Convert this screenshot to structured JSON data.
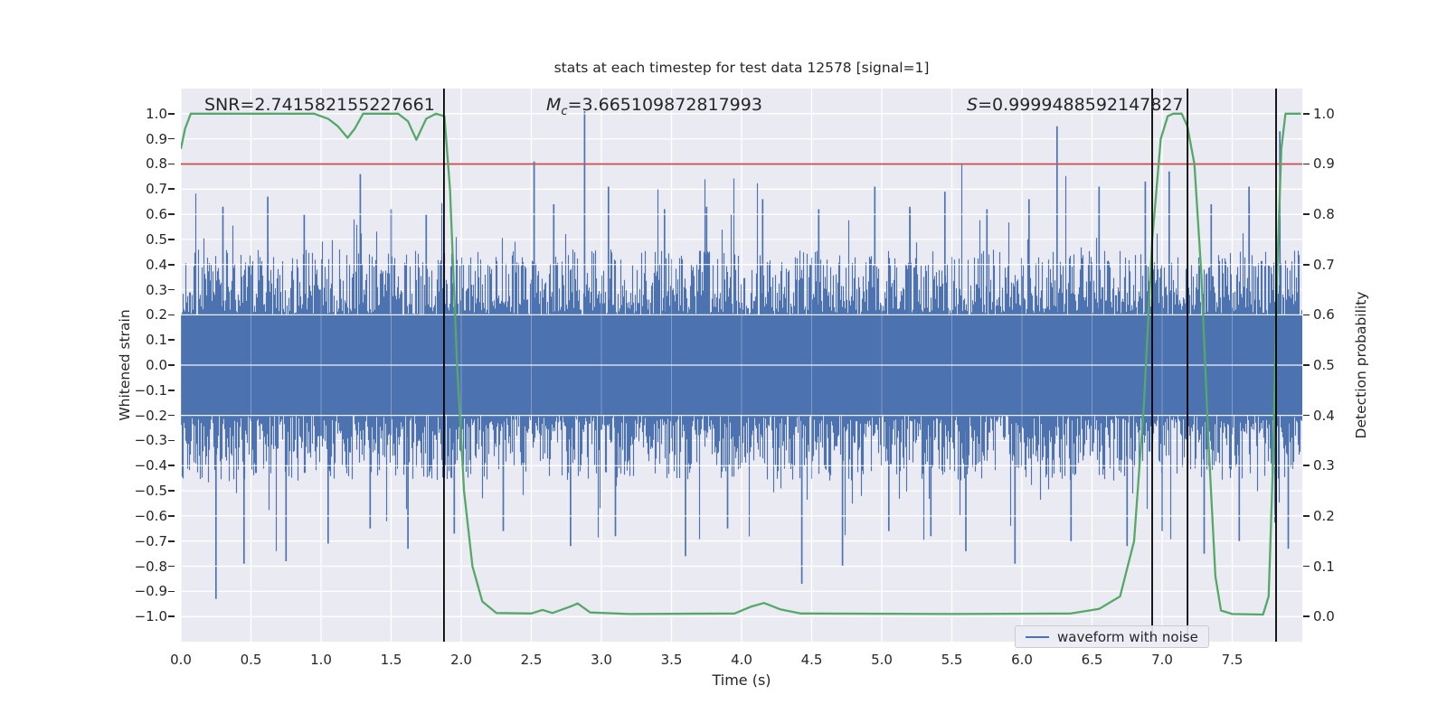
{
  "title": "stats at each timestep for test data 12578 [signal=1]",
  "annotations": {
    "snr": {
      "text": "SNR=2.741582155227661"
    },
    "chirp_mass": {
      "symbol": "M",
      "subscript": "c",
      "value": "=3.665109872817993"
    },
    "score": {
      "symbol": "S",
      "value": "=0.9999488592147827"
    }
  },
  "axes": {
    "x": {
      "label": "Time (s)",
      "range": [
        0.0,
        8.0
      ],
      "ticks": [
        0.0,
        0.5,
        1.0,
        1.5,
        2.0,
        2.5,
        3.0,
        3.5,
        4.0,
        4.5,
        5.0,
        5.5,
        6.0,
        6.5,
        7.0,
        7.5
      ]
    },
    "y_left": {
      "label": "Whitened strain",
      "range": [
        -1.1,
        1.1
      ],
      "ticks": [
        1.0,
        0.9,
        0.8,
        0.7,
        0.6,
        0.5,
        0.4,
        0.3,
        0.2,
        0.1,
        0.0,
        -0.1,
        -0.2,
        -0.3,
        -0.4,
        -0.5,
        -0.6,
        -0.7,
        -0.8,
        -0.9,
        -1.0
      ]
    },
    "y_right": {
      "label": "Detection probability",
      "range": [
        -0.05,
        1.05
      ],
      "ticks": [
        1.0,
        0.9,
        0.8,
        0.7,
        0.6,
        0.5,
        0.4,
        0.3,
        0.2,
        0.1,
        0.0
      ]
    }
  },
  "legend": {
    "label": "waveform with noise"
  },
  "colors": {
    "figure_bg": "#ffffff",
    "axes_bg": "#eaeaf2",
    "grid": "#ffffff",
    "waveform": "#4c72b0",
    "probability": "#55a868",
    "threshold": "#c44e52",
    "marker_lines": "#000000",
    "text": "#262626"
  },
  "chart_data": {
    "type": "line",
    "title": "stats at each timestep for test data 12578 [signal=1]",
    "xlabel": "Time (s)",
    "ylabel_left": "Whitened strain",
    "ylabel_right": "Detection probability",
    "xlim": [
      0.0,
      8.0
    ],
    "ylim_left": [
      -1.1,
      1.1
    ],
    "ylim_right": [
      -0.05,
      1.05
    ],
    "grid": true,
    "legend_position": "lower right",
    "stats": {
      "SNR": 2.741582155227661,
      "Mc": 3.665109872817993,
      "S": 0.9999488592147827,
      "signal": 1,
      "test_data_id": 12578
    },
    "threshold_line": {
      "axis": "right",
      "value": 0.9,
      "color": "#c44e52"
    },
    "vlines": [
      1.877,
      6.929,
      7.181,
      7.813
    ],
    "series": [
      {
        "name": "waveform with noise",
        "color": "#4c72b0",
        "style": "dense-noise",
        "axis": "left",
        "noise": {
          "seed": 12578,
          "core_band": 0.2,
          "typical_extra": 0.26,
          "tail_chance": 0.045,
          "tail_extra": 0.3
        },
        "landmark_peaks": [
          [
            0.3,
            0.63
          ],
          [
            0.62,
            0.67
          ],
          [
            0.88,
            0.6
          ],
          [
            1.28,
            0.76
          ],
          [
            1.5,
            0.62
          ],
          [
            1.75,
            0.6
          ],
          [
            2.52,
            0.81
          ],
          [
            2.66,
            0.64
          ],
          [
            2.88,
            1.01
          ],
          [
            3.05,
            0.71
          ],
          [
            3.45,
            0.62
          ],
          [
            3.75,
            0.63
          ],
          [
            4.15,
            0.66
          ],
          [
            4.55,
            0.62
          ],
          [
            4.95,
            0.71
          ],
          [
            5.2,
            0.63
          ],
          [
            5.45,
            0.69
          ],
          [
            5.75,
            0.62
          ],
          [
            6.05,
            0.66
          ],
          [
            6.25,
            0.95
          ],
          [
            6.55,
            0.71
          ],
          [
            6.88,
            0.73
          ],
          [
            7.05,
            0.77
          ],
          [
            7.35,
            0.64
          ],
          [
            7.62,
            0.71
          ],
          [
            7.84,
            0.93
          ]
        ],
        "landmark_troughs": [
          [
            0.25,
            -0.93
          ],
          [
            0.45,
            -0.79
          ],
          [
            0.75,
            -0.78
          ],
          [
            1.05,
            -0.71
          ],
          [
            1.35,
            -0.65
          ],
          [
            1.62,
            -0.73
          ],
          [
            1.95,
            -0.67
          ],
          [
            2.3,
            -0.66
          ],
          [
            2.78,
            -0.72
          ],
          [
            3.1,
            -0.68
          ],
          [
            3.6,
            -0.76
          ],
          [
            3.9,
            -0.65
          ],
          [
            4.43,
            -0.87
          ],
          [
            4.72,
            -0.8
          ],
          [
            5.05,
            -0.66
          ],
          [
            5.35,
            -0.68
          ],
          [
            5.6,
            -0.74
          ],
          [
            5.95,
            -0.79
          ],
          [
            6.35,
            -0.7
          ],
          [
            6.75,
            -0.72
          ],
          [
            7.0,
            -0.66
          ],
          [
            7.3,
            -0.75
          ],
          [
            7.55,
            -0.7
          ],
          [
            7.9,
            -0.73
          ]
        ]
      },
      {
        "name": "detection probability",
        "color": "#55a868",
        "axis": "right",
        "points": [
          [
            0.0,
            0.93
          ],
          [
            0.03,
            0.97
          ],
          [
            0.07,
            1.0
          ],
          [
            0.95,
            1.0
          ],
          [
            1.05,
            0.99
          ],
          [
            1.12,
            0.975
          ],
          [
            1.19,
            0.952
          ],
          [
            1.24,
            0.97
          ],
          [
            1.3,
            1.0
          ],
          [
            1.55,
            1.0
          ],
          [
            1.62,
            0.985
          ],
          [
            1.68,
            0.948
          ],
          [
            1.75,
            0.99
          ],
          [
            1.82,
            1.0
          ],
          [
            1.88,
            0.995
          ],
          [
            1.92,
            0.85
          ],
          [
            1.97,
            0.5
          ],
          [
            2.02,
            0.25
          ],
          [
            2.08,
            0.1
          ],
          [
            2.15,
            0.03
          ],
          [
            2.25,
            0.007
          ],
          [
            2.5,
            0.006
          ],
          [
            2.58,
            0.013
          ],
          [
            2.65,
            0.007
          ],
          [
            2.78,
            0.02
          ],
          [
            2.83,
            0.026
          ],
          [
            2.92,
            0.008
          ],
          [
            3.2,
            0.005
          ],
          [
            3.95,
            0.006
          ],
          [
            4.07,
            0.02
          ],
          [
            4.16,
            0.027
          ],
          [
            4.28,
            0.014
          ],
          [
            4.42,
            0.006
          ],
          [
            5.5,
            0.005
          ],
          [
            6.35,
            0.006
          ],
          [
            6.55,
            0.015
          ],
          [
            6.7,
            0.04
          ],
          [
            6.8,
            0.15
          ],
          [
            6.87,
            0.42
          ],
          [
            6.93,
            0.75
          ],
          [
            6.99,
            0.95
          ],
          [
            7.04,
            0.995
          ],
          [
            7.08,
            1.0
          ],
          [
            7.14,
            1.0
          ],
          [
            7.18,
            0.975
          ],
          [
            7.23,
            0.9
          ],
          [
            7.28,
            0.68
          ],
          [
            7.33,
            0.35
          ],
          [
            7.38,
            0.08
          ],
          [
            7.42,
            0.012
          ],
          [
            7.5,
            0.005
          ],
          [
            7.72,
            0.004
          ],
          [
            7.76,
            0.04
          ],
          [
            7.79,
            0.3
          ],
          [
            7.82,
            0.68
          ],
          [
            7.85,
            0.93
          ],
          [
            7.88,
            1.0
          ],
          [
            7.99,
            1.0
          ]
        ]
      }
    ]
  }
}
